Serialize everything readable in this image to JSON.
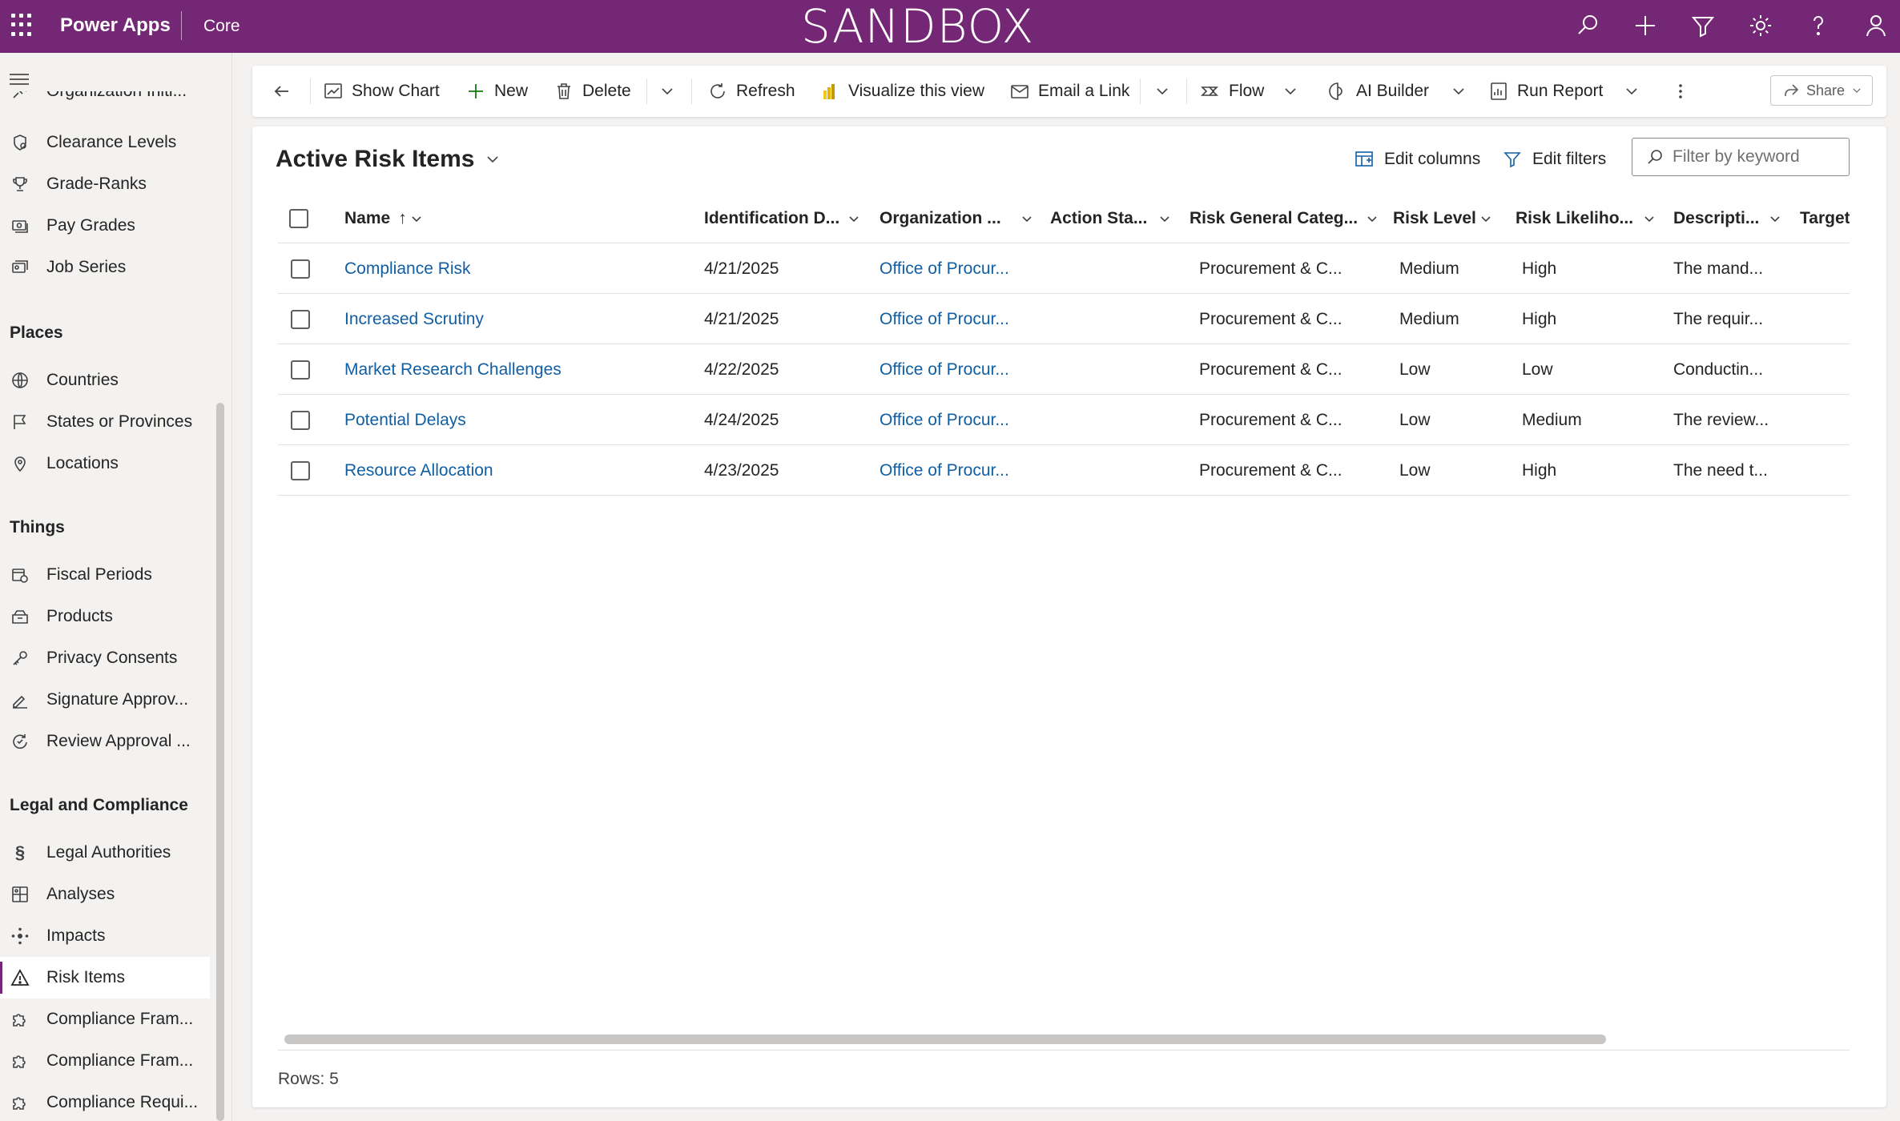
{
  "header": {
    "app_name": "Power Apps",
    "environment": "Core",
    "banner": "SANDBOX",
    "icons": [
      "waffle-icon",
      "search-icon",
      "plus-icon",
      "filter-icon",
      "settings-icon",
      "help-icon",
      "user-icon"
    ]
  },
  "sidebar": {
    "cut_item": "Organization Initi...",
    "groups": [
      {
        "title": "",
        "items": [
          {
            "label": "Clearance Levels",
            "icon": "shield-key-icon"
          },
          {
            "label": "Grade-Ranks",
            "icon": "trophy-icon"
          },
          {
            "label": "Pay Grades",
            "icon": "money-icon"
          },
          {
            "label": "Job Series",
            "icon": "id-stack-icon"
          }
        ]
      },
      {
        "title": "Places",
        "items": [
          {
            "label": "Countries",
            "icon": "globe-icon"
          },
          {
            "label": "States or Provinces",
            "icon": "flag-icon"
          },
          {
            "label": "Locations",
            "icon": "location-pin-icon"
          }
        ]
      },
      {
        "title": "Things",
        "items": [
          {
            "label": "Fiscal Periods",
            "icon": "calendar-clock-icon"
          },
          {
            "label": "Products",
            "icon": "box-icon"
          },
          {
            "label": "Privacy Consents",
            "icon": "key-icon"
          },
          {
            "label": "Signature Approv...",
            "icon": "signature-icon"
          },
          {
            "label": "Review Approval ...",
            "icon": "review-icon"
          }
        ]
      },
      {
        "title": "Legal and Compliance",
        "items": [
          {
            "label": "Legal Authorities",
            "icon": "section-sign-icon"
          },
          {
            "label": "Analyses",
            "icon": "analysis-icon"
          },
          {
            "label": "Impacts",
            "icon": "impact-icon"
          },
          {
            "label": "Risk Items",
            "icon": "warning-icon",
            "active": true
          },
          {
            "label": "Compliance Fram...",
            "icon": "puzzle-icon"
          },
          {
            "label": "Compliance Fram...",
            "icon": "puzzle-icon"
          },
          {
            "label": "Compliance Requi...",
            "icon": "puzzle-icon"
          }
        ]
      }
    ]
  },
  "toolbar": {
    "back": "back-arrow-icon",
    "show_chart": "Show Chart",
    "new": "New",
    "delete": "Delete",
    "refresh": "Refresh",
    "visualize": "Visualize this view",
    "email_link": "Email a Link",
    "flow": "Flow",
    "ai_builder": "AI Builder",
    "run_report": "Run Report",
    "share": "Share"
  },
  "view": {
    "title": "Active Risk Items",
    "edit_columns": "Edit columns",
    "edit_filters": "Edit filters",
    "filter_placeholder": "Filter by keyword"
  },
  "grid": {
    "columns": [
      "Name",
      "Identification D...",
      "Organization ...",
      "Action Sta...",
      "Risk General Categ...",
      "Risk Level",
      "Risk Likeliho...",
      "Descripti...",
      "Target"
    ],
    "rows": [
      {
        "name": "Compliance Risk",
        "date": "4/21/2025",
        "org": "Office of Procur...",
        "action": "",
        "category": "Procurement & C...",
        "level": "Medium",
        "likelihood": "High",
        "description": "The mand..."
      },
      {
        "name": "Increased Scrutiny",
        "date": "4/21/2025",
        "org": "Office of Procur...",
        "action": "",
        "category": "Procurement & C...",
        "level": "Medium",
        "likelihood": "High",
        "description": "The requir..."
      },
      {
        "name": "Market Research Challenges",
        "date": "4/22/2025",
        "org": "Office of Procur...",
        "action": "",
        "category": "Procurement & C...",
        "level": "Low",
        "likelihood": "Low",
        "description": "Conductin..."
      },
      {
        "name": "Potential Delays",
        "date": "4/24/2025",
        "org": "Office of Procur...",
        "action": "",
        "category": "Procurement & C...",
        "level": "Low",
        "likelihood": "Medium",
        "description": "The review..."
      },
      {
        "name": "Resource Allocation",
        "date": "4/23/2025",
        "org": "Office of Procur...",
        "action": "",
        "category": "Procurement & C...",
        "level": "Low",
        "likelihood": "High",
        "description": "The need t..."
      }
    ],
    "rows_label": "Rows: 5"
  },
  "colors": {
    "header_bg": "#742774",
    "link": "#115ea3",
    "text": "#242424"
  }
}
